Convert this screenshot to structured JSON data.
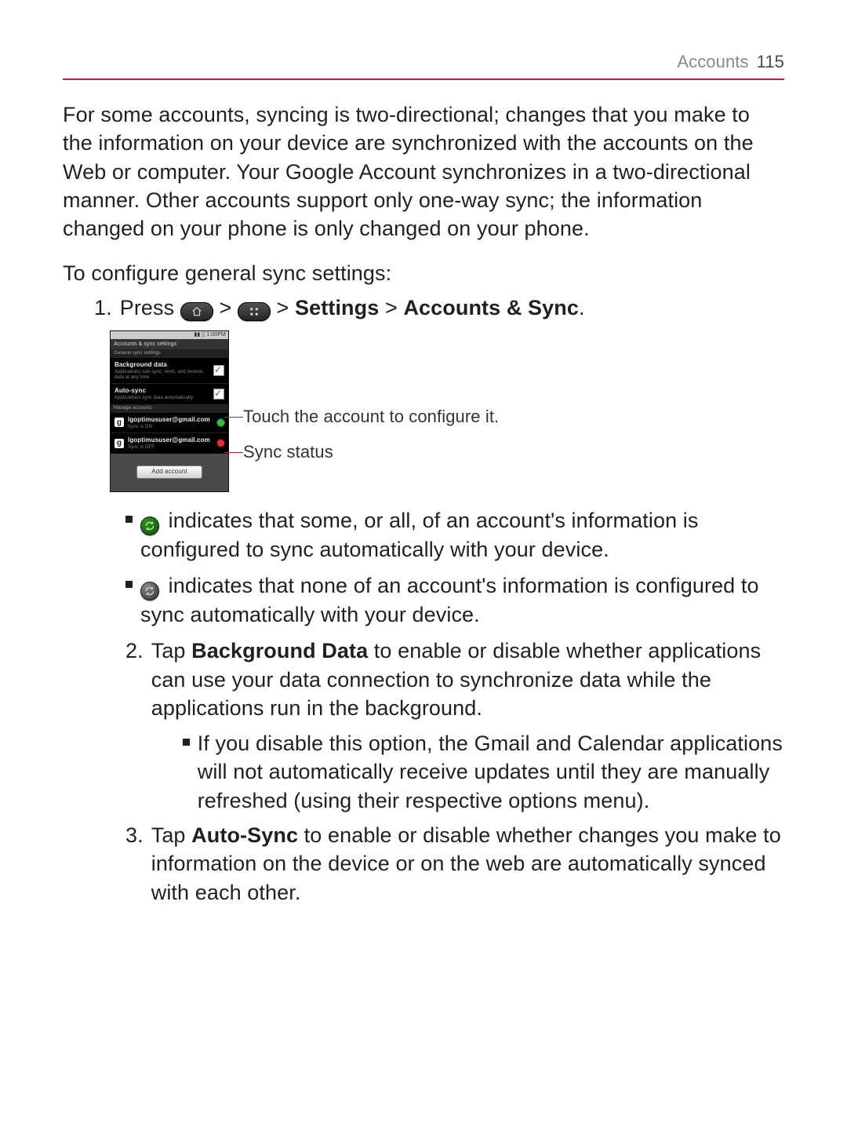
{
  "header": {
    "section": "Accounts",
    "page_number": "115"
  },
  "intro": "For some accounts, syncing is two-directional; changes that you make to the information on your device are synchronized with the accounts on the Web or computer. Your Google Account synchronizes in a two-directional manner. Other accounts support only one-way sync; the information changed on your phone is only changed on your phone.",
  "subhead": "To configure general sync settings:",
  "step1": {
    "num": "1.",
    "pre": "Press ",
    "sep": " > ",
    "path_a": "Settings",
    "path_b": "Accounts & Sync",
    "tail": "."
  },
  "phone": {
    "status_time": "1:00PM",
    "title": "Accounts & sync settings",
    "section1": "General sync settings",
    "row_bg_t": "Background data",
    "row_bg_s": "Applications can sync, send, and receive data at any time",
    "row_as_t": "Auto-sync",
    "row_as_s": "Applications sync data automatically",
    "section2": "Manage accounts",
    "acct1_t": "lgoptimususer@gmail.com",
    "acct1_s": "Sync is ON",
    "acct2_t": "lgoptimususer@gmail.com",
    "acct2_s": "Sync is OFF",
    "add_btn": "Add account"
  },
  "callouts": {
    "a": "Touch the account to configure it.",
    "b": "Sync status"
  },
  "bullet_on": "indicates that some, or all, of an account's information is configured to sync automatically with your device.",
  "bullet_off": "indicates that none of an account's information is configured to sync automatically with your device.",
  "step2": {
    "num": "2.",
    "lead": "Tap ",
    "bold": "Background Data",
    "rest": " to enable or disable whether applications can use your data connection to synchronize data while the applications run in the background.",
    "nested": "If you disable this option, the Gmail and Calendar applications will not automatically receive updates until they are manually refreshed (using their respective options menu)."
  },
  "step3": {
    "num": "3.",
    "lead": "Tap ",
    "bold": "Auto-Sync",
    "rest": " to enable or disable whether changes you make to information on the device or on the web are automatically synced with each other."
  }
}
